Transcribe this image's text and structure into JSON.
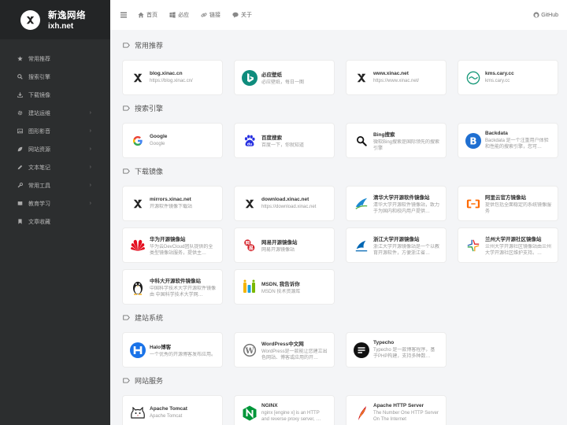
{
  "brand": {
    "name": "新逸网络",
    "domain": "ixh.net"
  },
  "sidebar": {
    "items": [
      {
        "label": "常用推荐",
        "icon": "star-icon",
        "expandable": false
      },
      {
        "label": "搜索引擎",
        "icon": "search-icon",
        "expandable": false
      },
      {
        "label": "下载镜像",
        "icon": "download-icon",
        "expandable": false
      },
      {
        "label": "建站运维",
        "icon": "gear-icon",
        "expandable": true
      },
      {
        "label": "图形影音",
        "icon": "image-icon",
        "expandable": true
      },
      {
        "label": "网站资源",
        "icon": "leaf-icon",
        "expandable": true
      },
      {
        "label": "文本笔记",
        "icon": "pencil-icon",
        "expandable": true
      },
      {
        "label": "常用工具",
        "icon": "wrench-icon",
        "expandable": true
      },
      {
        "label": "教育学习",
        "icon": "book-icon",
        "expandable": true
      },
      {
        "label": "文章收藏",
        "icon": "bookmark-icon",
        "expandable": false
      }
    ]
  },
  "topbar": {
    "nav": [
      {
        "label": "首页",
        "icon": "home-icon"
      },
      {
        "label": "必应",
        "icon": "windows-icon"
      },
      {
        "label": "链接",
        "icon": "link-icon"
      },
      {
        "label": "关于",
        "icon": "chat-icon"
      }
    ],
    "github_label": "GitHub"
  },
  "colors": {
    "sidebar_bg": "#2c2e2f",
    "brand_bg": "#232526",
    "page_bg": "#f4f5f7",
    "card_bg": "#ffffff"
  },
  "sections": [
    {
      "title": "常用推荐",
      "cards": [
        {
          "title": "blog.xinac.cn",
          "desc": "https://blog.xinac.cn/",
          "icon": "xinac-logo-icon"
        },
        {
          "title": "必应壁纸",
          "desc": "必应壁纸，每日一图",
          "icon": "bing-wallpaper-icon"
        },
        {
          "title": "www.xinac.net",
          "desc": "https://www.xinac.net/",
          "icon": "xinac-logo-icon"
        },
        {
          "title": "kms.cary.cc",
          "desc": "kms.cary.cc",
          "icon": "kms-logo-icon"
        }
      ]
    },
    {
      "title": "搜索引擎",
      "cards": [
        {
          "title": "Google",
          "desc": "Google",
          "icon": "google-icon"
        },
        {
          "title": "百度搜索",
          "desc": "百度一下，你就知道",
          "icon": "baidu-icon"
        },
        {
          "title": "Bing搜索",
          "desc": "微软Bing搜索是国际领先的搜索引擎",
          "icon": "bing-search-icon"
        },
        {
          "title": "Backdata",
          "desc": "Backdata 是一个注重用户体验和性能的搜索引擎，您可…",
          "icon": "backdata-icon"
        }
      ]
    },
    {
      "title": "下载镜像",
      "cards": [
        {
          "title": "mirrors.xinac.net",
          "desc": "开源软件镜像下载站",
          "icon": "xinac-logo-icon"
        },
        {
          "title": "download.xinac.net",
          "desc": "https://download.xinac.net",
          "icon": "xinac-logo-icon"
        },
        {
          "title": "清华大学开源软件镜像站",
          "desc": "清华大学开源软件镜像站，致力于为国内和校内用户提供…",
          "icon": "tsinghua-icon"
        },
        {
          "title": "阿里云官方镜像站",
          "desc": "提供包括全面稳定的系统镜像服务",
          "icon": "aliyun-icon"
        },
        {
          "title": "华为开源镜像站",
          "desc": "华为云DevCloud团队提供的全类型镜像站服务，提供主…",
          "icon": "huawei-icon"
        },
        {
          "title": "网易开源镜像站",
          "desc": "网易开源镜像站",
          "icon": "netease-icon"
        },
        {
          "title": "浙江大学开源镜像站",
          "desc": "浙江大学开源镜像站是一个以教育开源软件，方便浙江省…",
          "icon": "zju-icon"
        },
        {
          "title": "兰州大学开源社区镜像站",
          "desc": "兰州大学开源社区镜像站由兰州大学开源社区维护支持。…",
          "icon": "lzu-icon"
        },
        {
          "title": "中科大开源软件镜像站",
          "desc": "中国科学技术大学开源软件镜像由 中国科学技术大学网…",
          "icon": "ustc-icon"
        },
        {
          "title": "MSDN, 我告诉你",
          "desc": "MSDN 技术资源库",
          "icon": "msdn-icon"
        }
      ]
    },
    {
      "title": "建站系统",
      "cards": [
        {
          "title": "Halo博客",
          "desc": "一个优秀的开源博客发布应用。",
          "icon": "halo-icon"
        },
        {
          "title": "WordPress中文网",
          "desc": "WordPress是一款能让您建立出色网站、博客或应用的开…",
          "icon": "wordpress-icon"
        },
        {
          "title": "Typecho",
          "desc": "Typecho 是一款博客程序，基于PHP构建，支持多种数…",
          "icon": "typecho-icon"
        }
      ]
    },
    {
      "title": "网站服务",
      "cards": [
        {
          "title": "Apache Tomcat",
          "desc": "Apache Tomcat",
          "icon": "tomcat-icon"
        },
        {
          "title": "NGINX",
          "desc": "nginx [engine x] is an HTTP and reverse proxy server, …",
          "icon": "nginx-icon"
        },
        {
          "title": "Apache HTTP Server",
          "desc": "The Number One HTTP Server On The Internet",
          "icon": "apache-icon"
        }
      ]
    }
  ]
}
